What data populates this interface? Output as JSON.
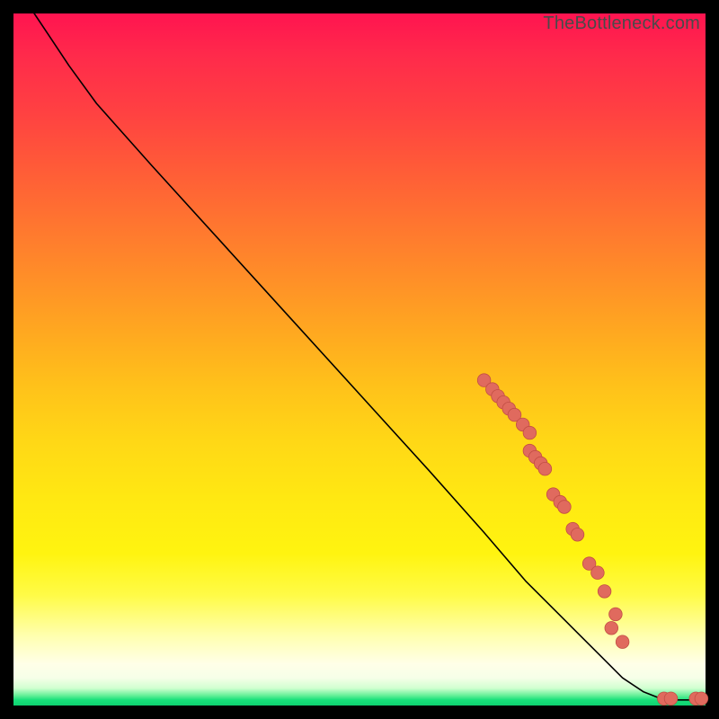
{
  "watermark": "TheBottleneck.com",
  "colors": {
    "marker_fill": "#e06a5e",
    "marker_stroke": "#c24e44",
    "curve": "#000000",
    "background": "#000000"
  },
  "chart_data": {
    "type": "line",
    "title": "",
    "xlabel": "",
    "ylabel": "",
    "xlim": [
      0,
      100
    ],
    "ylim": [
      0,
      100
    ],
    "curve": {
      "comment": "x,y in percent of plot area; y=0 is top, y=100 is bottom (screen coords). Curve starts top-left, descends with slight initial convexity, then near-linear to bottom-right, with a small flat tail at the very bottom.",
      "points": [
        [
          3,
          0
        ],
        [
          5,
          3
        ],
        [
          8,
          7.5
        ],
        [
          12,
          13
        ],
        [
          20,
          22
        ],
        [
          30,
          33
        ],
        [
          40,
          44
        ],
        [
          50,
          55
        ],
        [
          60,
          66
        ],
        [
          68,
          75
        ],
        [
          74,
          82
        ],
        [
          80,
          88
        ],
        [
          85,
          93
        ],
        [
          88,
          96
        ],
        [
          91,
          98
        ],
        [
          93.5,
          99
        ],
        [
          96,
          99.2
        ],
        [
          99,
          99.2
        ]
      ]
    },
    "markers": {
      "comment": "approximate salmon dot positions along the lower segment of the curve, in percent of plot area (screen coords).",
      "points": [
        [
          68.0,
          53.0
        ],
        [
          69.2,
          54.3
        ],
        [
          70.0,
          55.3
        ],
        [
          70.8,
          56.2
        ],
        [
          71.6,
          57.1
        ],
        [
          72.4,
          58.0
        ],
        [
          73.6,
          59.4
        ],
        [
          74.6,
          60.6
        ],
        [
          74.6,
          63.2
        ],
        [
          75.4,
          64.1
        ],
        [
          76.2,
          65.0
        ],
        [
          76.8,
          65.8
        ],
        [
          78.0,
          69.5
        ],
        [
          79.0,
          70.6
        ],
        [
          79.6,
          71.3
        ],
        [
          80.8,
          74.5
        ],
        [
          81.5,
          75.3
        ],
        [
          83.2,
          79.5
        ],
        [
          84.4,
          80.8
        ],
        [
          85.4,
          83.5
        ],
        [
          87.0,
          86.8
        ],
        [
          86.4,
          88.8
        ],
        [
          88.0,
          90.8
        ],
        [
          94.0,
          99.0
        ],
        [
          95.0,
          99.0
        ],
        [
          98.6,
          99.0
        ],
        [
          99.4,
          99.0
        ]
      ],
      "radius_pct": 0.95
    }
  }
}
